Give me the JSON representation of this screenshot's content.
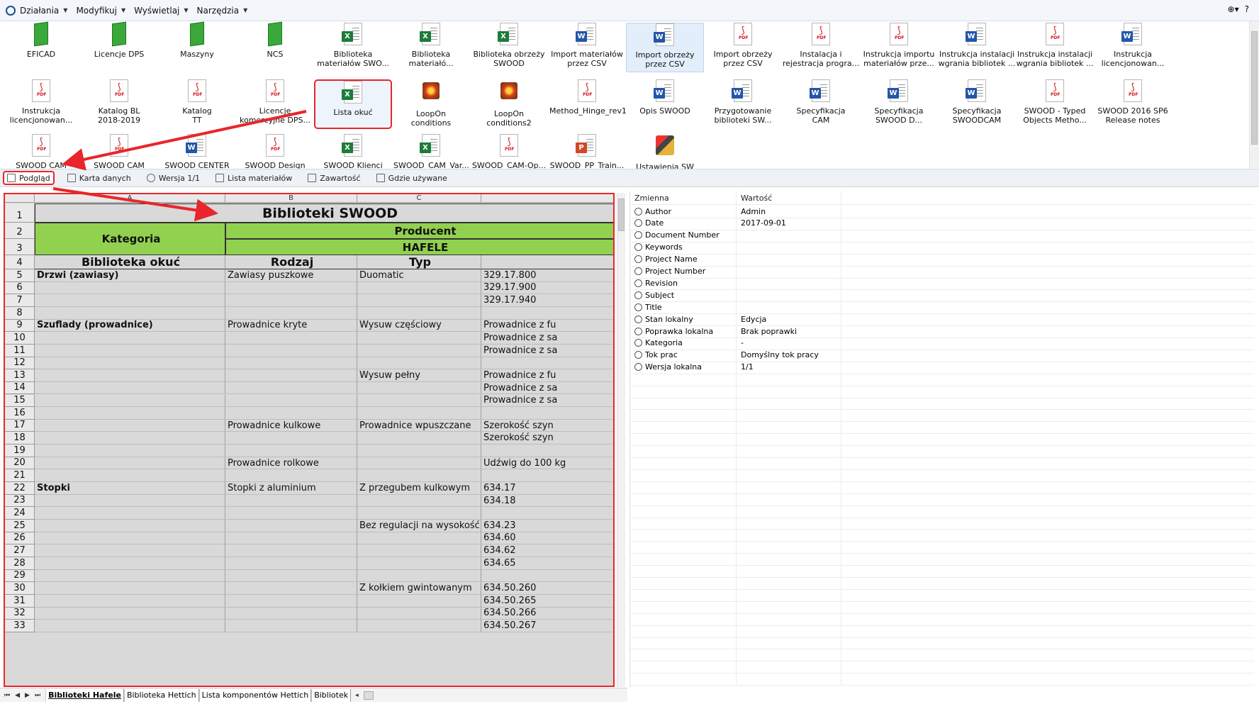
{
  "menu": {
    "items": [
      {
        "label": "Działania"
      },
      {
        "label": "Modyfikuj"
      },
      {
        "label": "Wyświetlaj"
      },
      {
        "label": "Narzędzia"
      }
    ]
  },
  "files": [
    {
      "label1": "EFICAD",
      "label2": "",
      "type": "folder"
    },
    {
      "label1": "Licencje DPS",
      "label2": "",
      "type": "folder"
    },
    {
      "label1": "Maszyny",
      "label2": "",
      "type": "folder"
    },
    {
      "label1": "NCS",
      "label2": "",
      "type": "folder"
    },
    {
      "label1": "Biblioteka",
      "label2": "materiałów SWO...",
      "type": "excel"
    },
    {
      "label1": "Biblioteka",
      "label2": "materiałó...",
      "type": "excel"
    },
    {
      "label1": "Biblioteka obrzeży",
      "label2": "SWOOD",
      "type": "excel"
    },
    {
      "label1": "Import materiałów",
      "label2": "przez CSV",
      "type": "word"
    },
    {
      "label1": "Import obrzeży",
      "label2": "przez CSV",
      "type": "word"
    },
    {
      "label1": "Import obrzeży",
      "label2": "przez CSV",
      "type": "pdf"
    },
    {
      "label1": "Instalacja i",
      "label2": "rejestracja progra...",
      "type": "pdf"
    },
    {
      "label1": "Instrukcja importu",
      "label2": "materiałów prze...",
      "type": "pdf"
    },
    {
      "label1": "Instrukcja instalacji i",
      "label2": "wgrania bibliotek ...",
      "type": "word"
    },
    {
      "label1": "Instrukcja instalacji i",
      "label2": "wgrania bibliotek ...",
      "type": "pdf"
    },
    {
      "label1": "Instrukcja",
      "label2": "licencjonowan...",
      "type": "word"
    },
    {
      "label1": "Instrukcja",
      "label2": "licencjonowan...",
      "type": "pdf"
    },
    {
      "label1": "Katalog BL",
      "label2": "2018-2019",
      "type": "pdf"
    },
    {
      "label1": "Katalog",
      "label2": "TT",
      "type": "pdf"
    },
    {
      "label1": "Licencje",
      "label2": "komercyjne DPS...",
      "type": "pdf"
    },
    {
      "label1": "Lista okuć",
      "label2": "",
      "type": "excel"
    },
    {
      "label1": "LoopOn",
      "label2": "conditions",
      "type": "flower"
    },
    {
      "label1": "LoopOn",
      "label2": "conditions2",
      "type": "flower"
    },
    {
      "label1": "Method_Hinge_rev1",
      "label2": "",
      "type": "pdf"
    },
    {
      "label1": "Opis SWOOD",
      "label2": "",
      "type": "word"
    },
    {
      "label1": "Przygotowanie",
      "label2": "biblioteki SW...",
      "type": "word"
    },
    {
      "label1": "Specyfikacja",
      "label2": "CAM",
      "type": "word"
    },
    {
      "label1": "Specyfikacja",
      "label2": "SWOOD D...",
      "type": "word"
    },
    {
      "label1": "Specyfikacja",
      "label2": "SWOODCAM",
      "type": "word"
    },
    {
      "label1": "SWOOD - Typed",
      "label2": "Objects Metho...",
      "type": "pdf"
    },
    {
      "label1": "SWOOD 2016 SP6",
      "label2": "Release notes",
      "type": "pdf"
    },
    {
      "label1": "SWOOD CAM",
      "label2": "",
      "type": "pdf"
    },
    {
      "label1": "SWOOD CAM",
      "label2": "",
      "type": "pdf"
    },
    {
      "label1": "SWOOD CENTER",
      "label2": "",
      "type": "word"
    },
    {
      "label1": "SWOOD Design",
      "label2": "",
      "type": "pdf"
    },
    {
      "label1": "SWOOD Klienci",
      "label2": "",
      "type": "excel"
    },
    {
      "label1": "SWOOD_CAM_Var...",
      "label2": "",
      "type": "excel"
    },
    {
      "label1": "SWOOD_CAM-Op...",
      "label2": "",
      "type": "pdf"
    },
    {
      "label1": "SWOOD_PP_Train...",
      "label2": "",
      "type": "ppt"
    },
    {
      "label1": "Ustawienia SW",
      "label2": "",
      "type": "tool"
    }
  ],
  "tabs": [
    {
      "label": "Podgląd"
    },
    {
      "label": "Karta danych"
    },
    {
      "label": "Wersja 1/1"
    },
    {
      "label": "Lista materiałów"
    },
    {
      "label": "Zawartość"
    },
    {
      "label": "Gdzie używane"
    }
  ],
  "sheet": {
    "columns": [
      "A",
      "B",
      "C"
    ],
    "title": "Biblioteki SWOOD",
    "kategoria": "Kategoria",
    "producent": "Producent",
    "hafele": "HAFELE",
    "col_a_header": "Biblioteka okuć",
    "col_b_header": "Rodzaj",
    "col_c_header": "Typ",
    "rows": [
      {
        "n": "5",
        "a": "Drzwi (zawiasy)",
        "b": "Zawiasy puszkowe",
        "c": "Duomatic",
        "d": "329.17.800"
      },
      {
        "n": "6",
        "a": "",
        "b": "",
        "c": "",
        "d": "329.17.900"
      },
      {
        "n": "7",
        "a": "",
        "b": "",
        "c": "",
        "d": "329.17.940"
      },
      {
        "n": "8",
        "a": "",
        "b": "",
        "c": "",
        "d": ""
      },
      {
        "n": "9",
        "a": "Szuflady (prowadnice)",
        "b": "Prowadnice kryte",
        "c": "Wysuw częściowy",
        "d": "Prowadnice z fu"
      },
      {
        "n": "10",
        "a": "",
        "b": "",
        "c": "",
        "d": "Prowadnice z sa"
      },
      {
        "n": "11",
        "a": "",
        "b": "",
        "c": "",
        "d": "Prowadnice z sa"
      },
      {
        "n": "12",
        "a": "",
        "b": "",
        "c": "",
        "d": ""
      },
      {
        "n": "13",
        "a": "",
        "b": "",
        "c": "Wysuw pełny",
        "d": "Prowadnice z fu"
      },
      {
        "n": "14",
        "a": "",
        "b": "",
        "c": "",
        "d": "Prowadnice z sa"
      },
      {
        "n": "15",
        "a": "",
        "b": "",
        "c": "",
        "d": "Prowadnice z sa"
      },
      {
        "n": "16",
        "a": "",
        "b": "",
        "c": "",
        "d": ""
      },
      {
        "n": "17",
        "a": "",
        "b": "Prowadnice kulkowe",
        "c": "Prowadnice wpuszczane",
        "d": "Szerokość szyn"
      },
      {
        "n": "18",
        "a": "",
        "b": "",
        "c": "",
        "d": "Szerokość szyn"
      },
      {
        "n": "19",
        "a": "",
        "b": "",
        "c": "",
        "d": ""
      },
      {
        "n": "20",
        "a": "",
        "b": "Prowadnice rolkowe",
        "c": "",
        "d": "Udźwig do 100 kg"
      },
      {
        "n": "21",
        "a": "",
        "b": "",
        "c": "",
        "d": ""
      },
      {
        "n": "22",
        "a": "Stopki",
        "b": "Stopki z aluminium",
        "c": "Z przegubem kulkowym",
        "d": "634.17"
      },
      {
        "n": "23",
        "a": "",
        "b": "",
        "c": "",
        "d": "634.18"
      },
      {
        "n": "24",
        "a": "",
        "b": "",
        "c": "",
        "d": ""
      },
      {
        "n": "25",
        "a": "",
        "b": "",
        "c": "Bez regulacji na wysokość",
        "d": "634.23"
      },
      {
        "n": "26",
        "a": "",
        "b": "",
        "c": "",
        "d": "634.60"
      },
      {
        "n": "27",
        "a": "",
        "b": "",
        "c": "",
        "d": "634.62"
      },
      {
        "n": "28",
        "a": "",
        "b": "",
        "c": "",
        "d": "634.65"
      },
      {
        "n": "29",
        "a": "",
        "b": "",
        "c": "",
        "d": ""
      },
      {
        "n": "30",
        "a": "",
        "b": "",
        "c": "Z kołkiem gwintowanym",
        "d": "634.50.260"
      },
      {
        "n": "31",
        "a": "",
        "b": "",
        "c": "",
        "d": "634.50.265"
      },
      {
        "n": "32",
        "a": "",
        "b": "",
        "c": "",
        "d": "634.50.266"
      },
      {
        "n": "33",
        "a": "",
        "b": "",
        "c": "",
        "d": "634.50.267"
      }
    ],
    "sheet_tabs": [
      "Biblioteki Hafele",
      "Biblioteka Hettich",
      "Lista komponentów Hettich",
      "Bibliotek"
    ]
  },
  "properties": {
    "header_key": "Zmienna",
    "header_value": "Wartość",
    "rows": [
      {
        "key": "Author",
        "value": "Admin"
      },
      {
        "key": "Date",
        "value": "2017-09-01"
      },
      {
        "key": "Document Number",
        "value": ""
      },
      {
        "key": "Keywords",
        "value": ""
      },
      {
        "key": "Project Name",
        "value": ""
      },
      {
        "key": "Project Number",
        "value": ""
      },
      {
        "key": "Revision",
        "value": ""
      },
      {
        "key": "Subject",
        "value": ""
      },
      {
        "key": "Title",
        "value": ""
      },
      {
        "key": "Stan lokalny",
        "value": "Edycja"
      },
      {
        "key": "Poprawka lokalna",
        "value": "Brak poprawki"
      },
      {
        "key": "Kategoria",
        "value": "-"
      },
      {
        "key": "Tok prac",
        "value": "Domyślny tok pracy"
      },
      {
        "key": "Wersja lokalna",
        "value": "1/1"
      }
    ]
  },
  "colors": {
    "highlight_red": "#e8262b",
    "header_green": "#92d050",
    "cell_gray": "#d9d9d9"
  }
}
